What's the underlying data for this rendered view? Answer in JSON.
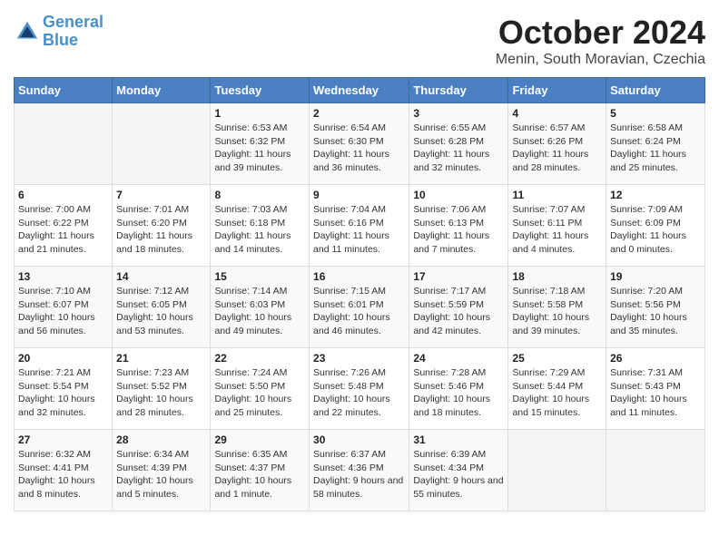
{
  "header": {
    "logo_line1": "General",
    "logo_line2": "Blue",
    "month": "October 2024",
    "location": "Menin, South Moravian, Czechia"
  },
  "days_of_week": [
    "Sunday",
    "Monday",
    "Tuesday",
    "Wednesday",
    "Thursday",
    "Friday",
    "Saturday"
  ],
  "weeks": [
    [
      {
        "num": "",
        "info": ""
      },
      {
        "num": "",
        "info": ""
      },
      {
        "num": "1",
        "info": "Sunrise: 6:53 AM\nSunset: 6:32 PM\nDaylight: 11 hours and 39 minutes."
      },
      {
        "num": "2",
        "info": "Sunrise: 6:54 AM\nSunset: 6:30 PM\nDaylight: 11 hours and 36 minutes."
      },
      {
        "num": "3",
        "info": "Sunrise: 6:55 AM\nSunset: 6:28 PM\nDaylight: 11 hours and 32 minutes."
      },
      {
        "num": "4",
        "info": "Sunrise: 6:57 AM\nSunset: 6:26 PM\nDaylight: 11 hours and 28 minutes."
      },
      {
        "num": "5",
        "info": "Sunrise: 6:58 AM\nSunset: 6:24 PM\nDaylight: 11 hours and 25 minutes."
      }
    ],
    [
      {
        "num": "6",
        "info": "Sunrise: 7:00 AM\nSunset: 6:22 PM\nDaylight: 11 hours and 21 minutes."
      },
      {
        "num": "7",
        "info": "Sunrise: 7:01 AM\nSunset: 6:20 PM\nDaylight: 11 hours and 18 minutes."
      },
      {
        "num": "8",
        "info": "Sunrise: 7:03 AM\nSunset: 6:18 PM\nDaylight: 11 hours and 14 minutes."
      },
      {
        "num": "9",
        "info": "Sunrise: 7:04 AM\nSunset: 6:16 PM\nDaylight: 11 hours and 11 minutes."
      },
      {
        "num": "10",
        "info": "Sunrise: 7:06 AM\nSunset: 6:13 PM\nDaylight: 11 hours and 7 minutes."
      },
      {
        "num": "11",
        "info": "Sunrise: 7:07 AM\nSunset: 6:11 PM\nDaylight: 11 hours and 4 minutes."
      },
      {
        "num": "12",
        "info": "Sunrise: 7:09 AM\nSunset: 6:09 PM\nDaylight: 11 hours and 0 minutes."
      }
    ],
    [
      {
        "num": "13",
        "info": "Sunrise: 7:10 AM\nSunset: 6:07 PM\nDaylight: 10 hours and 56 minutes."
      },
      {
        "num": "14",
        "info": "Sunrise: 7:12 AM\nSunset: 6:05 PM\nDaylight: 10 hours and 53 minutes."
      },
      {
        "num": "15",
        "info": "Sunrise: 7:14 AM\nSunset: 6:03 PM\nDaylight: 10 hours and 49 minutes."
      },
      {
        "num": "16",
        "info": "Sunrise: 7:15 AM\nSunset: 6:01 PM\nDaylight: 10 hours and 46 minutes."
      },
      {
        "num": "17",
        "info": "Sunrise: 7:17 AM\nSunset: 5:59 PM\nDaylight: 10 hours and 42 minutes."
      },
      {
        "num": "18",
        "info": "Sunrise: 7:18 AM\nSunset: 5:58 PM\nDaylight: 10 hours and 39 minutes."
      },
      {
        "num": "19",
        "info": "Sunrise: 7:20 AM\nSunset: 5:56 PM\nDaylight: 10 hours and 35 minutes."
      }
    ],
    [
      {
        "num": "20",
        "info": "Sunrise: 7:21 AM\nSunset: 5:54 PM\nDaylight: 10 hours and 32 minutes."
      },
      {
        "num": "21",
        "info": "Sunrise: 7:23 AM\nSunset: 5:52 PM\nDaylight: 10 hours and 28 minutes."
      },
      {
        "num": "22",
        "info": "Sunrise: 7:24 AM\nSunset: 5:50 PM\nDaylight: 10 hours and 25 minutes."
      },
      {
        "num": "23",
        "info": "Sunrise: 7:26 AM\nSunset: 5:48 PM\nDaylight: 10 hours and 22 minutes."
      },
      {
        "num": "24",
        "info": "Sunrise: 7:28 AM\nSunset: 5:46 PM\nDaylight: 10 hours and 18 minutes."
      },
      {
        "num": "25",
        "info": "Sunrise: 7:29 AM\nSunset: 5:44 PM\nDaylight: 10 hours and 15 minutes."
      },
      {
        "num": "26",
        "info": "Sunrise: 7:31 AM\nSunset: 5:43 PM\nDaylight: 10 hours and 11 minutes."
      }
    ],
    [
      {
        "num": "27",
        "info": "Sunrise: 6:32 AM\nSunset: 4:41 PM\nDaylight: 10 hours and 8 minutes."
      },
      {
        "num": "28",
        "info": "Sunrise: 6:34 AM\nSunset: 4:39 PM\nDaylight: 10 hours and 5 minutes."
      },
      {
        "num": "29",
        "info": "Sunrise: 6:35 AM\nSunset: 4:37 PM\nDaylight: 10 hours and 1 minute."
      },
      {
        "num": "30",
        "info": "Sunrise: 6:37 AM\nSunset: 4:36 PM\nDaylight: 9 hours and 58 minutes."
      },
      {
        "num": "31",
        "info": "Sunrise: 6:39 AM\nSunset: 4:34 PM\nDaylight: 9 hours and 55 minutes."
      },
      {
        "num": "",
        "info": ""
      },
      {
        "num": "",
        "info": ""
      }
    ]
  ]
}
